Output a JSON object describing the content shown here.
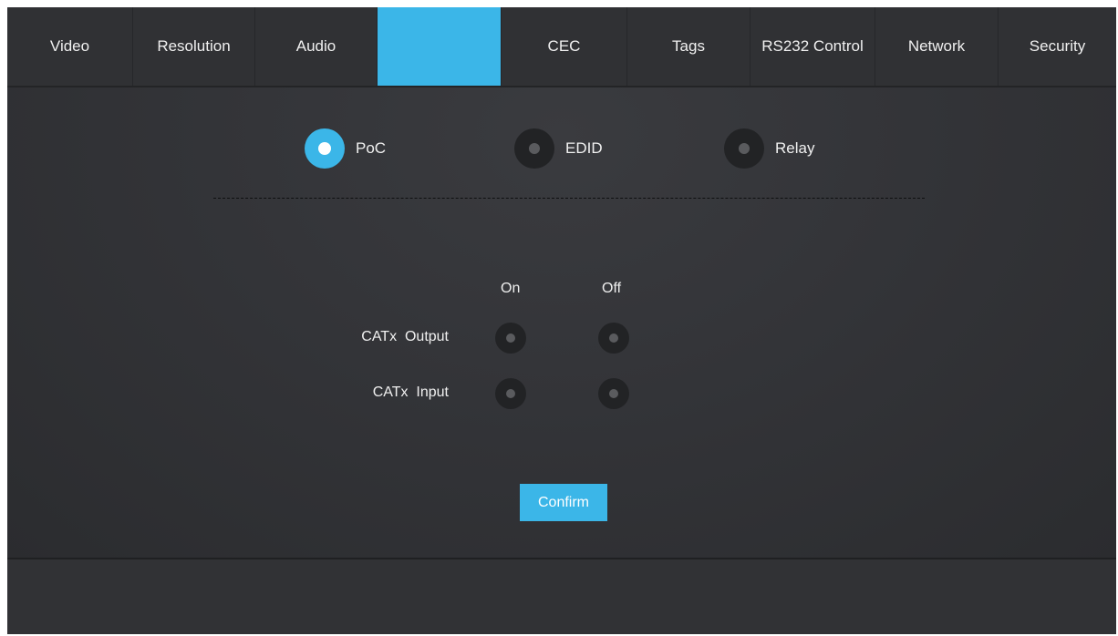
{
  "tabs": [
    {
      "label": "Video"
    },
    {
      "label": "Resolution"
    },
    {
      "label": "Audio"
    },
    {
      "label": ""
    },
    {
      "label": "CEC"
    },
    {
      "label": "Tags"
    },
    {
      "label": "RS232 Control"
    },
    {
      "label": "Network"
    },
    {
      "label": "Security"
    }
  ],
  "active_tab_index": 3,
  "modes": [
    {
      "label": "PoC",
      "selected": true
    },
    {
      "label": "EDID",
      "selected": false
    },
    {
      "label": "Relay",
      "selected": false
    }
  ],
  "catx": {
    "on_label": "On",
    "off_label": "Off",
    "rows": [
      {
        "label": "CATx  Output",
        "on": false,
        "off": false
      },
      {
        "label": "CATx  Input",
        "on": false,
        "off": false
      }
    ]
  },
  "confirm_label": "Confirm",
  "colors": {
    "accent": "#3bb6e8",
    "background": "#2f3033",
    "radio_off": "#222325"
  },
  "icons": {
    "radio": "radio-button-icon"
  }
}
